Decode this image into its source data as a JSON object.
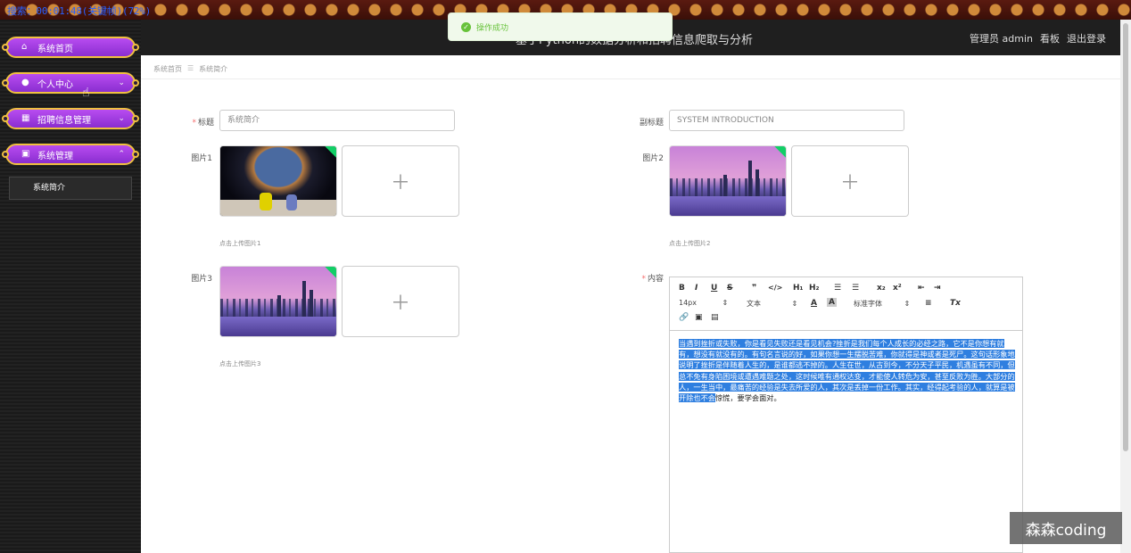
{
  "status_bar": {
    "text": "搜索：00:01:48(关键帧)(72%)"
  },
  "header": {
    "title": "基于Python的数据分析和招聘信息爬取与分析",
    "user": "管理员 admin",
    "dashboard_link": "看板",
    "logout_link": "退出登录"
  },
  "toast": {
    "message": "操作成功"
  },
  "sidebar": {
    "items": [
      {
        "label": "系统首页",
        "icon": "home-icon"
      },
      {
        "label": "个人中心",
        "icon": "user-icon"
      },
      {
        "label": "招聘信息管理",
        "icon": "grid-icon"
      },
      {
        "label": "系统管理",
        "icon": "settings-icon"
      }
    ],
    "sub_item": "系统简介"
  },
  "breadcrumb": {
    "home": "系统首页",
    "current": "系统简介"
  },
  "form": {
    "title_label": "标题",
    "title_value": "系统简介",
    "subtitle_label": "副标题",
    "subtitle_value": "SYSTEM INTRODUCTION",
    "image1_label": "图片1",
    "image1_hint": "点击上传图片1",
    "image2_label": "图片2",
    "image2_hint": "点击上传图片2",
    "image3_label": "图片3",
    "image3_hint": "点击上传图片3",
    "content_label": "内容"
  },
  "editor": {
    "font_size": "14px",
    "text_style": "文本",
    "font_family": "标准字体",
    "content_highlighted": "当遇到挫折或失败，你是看见失败还是看见机会?挫折是我们每个人成长的必经之路，它不是你想有就有，想没有就没有的。有句名言说的好，如果你想一生摆脱苦难，你就得是神或者是死尸。这句话形象地说明了挫折是伴随着人生的，是谁都逃不掉的。人生在世，从古到今，不分天子平民，机遇虽有不同，但总不免有身陷困境或遭遇难题之处，这时候唯有通权达变，才能使人转危为安，甚至反败为胜。大部分的人，一生当中，最痛苦的经验是失去所爱的人，其次是丢掉一份工作。其实，经得起考验的人，就算是被开除也不会",
    "content_rest": "惊慌，要学会面对。"
  },
  "watermark": "森森coding"
}
